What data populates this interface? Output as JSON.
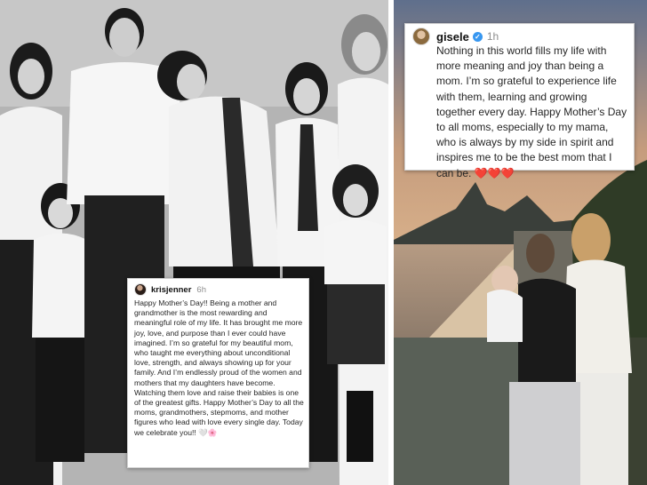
{
  "left_post": {
    "username": "krisjenner",
    "age": "6h",
    "caption": "Happy Mother’s Day!! Being a mother and grandmother is the most rewarding and meaningful role of my life. It has brought me more joy, love, and purpose than I ever could have imagined. I’m so grateful for my beautiful mom, who taught me everything about unconditional love, strength, and always showing up for your family. And I’m endlessly proud of the women and mothers that my daughters have become. Watching them love and raise their babies is one of the greatest gifts. Happy Mother’s Day to all the moms, grandmothers, stepmoms, and mother figures who lead with love every single day. Today we celebrate you!! 🤍🌸"
  },
  "right_post": {
    "username": "gisele",
    "verified": "✓",
    "age": "1h",
    "caption": "Nothing in this world fills my life with more meaning and joy than being a mom. I’m so grateful to experience life with them, learning and growing together every day. Happy Mother’s Day to all moms, especially to my mama, who is always by my side in spirit and inspires me to be the best mom that I can be. ❤️❤️❤️"
  },
  "icons": [
    "avatar-icon",
    "verified-badge-icon"
  ]
}
